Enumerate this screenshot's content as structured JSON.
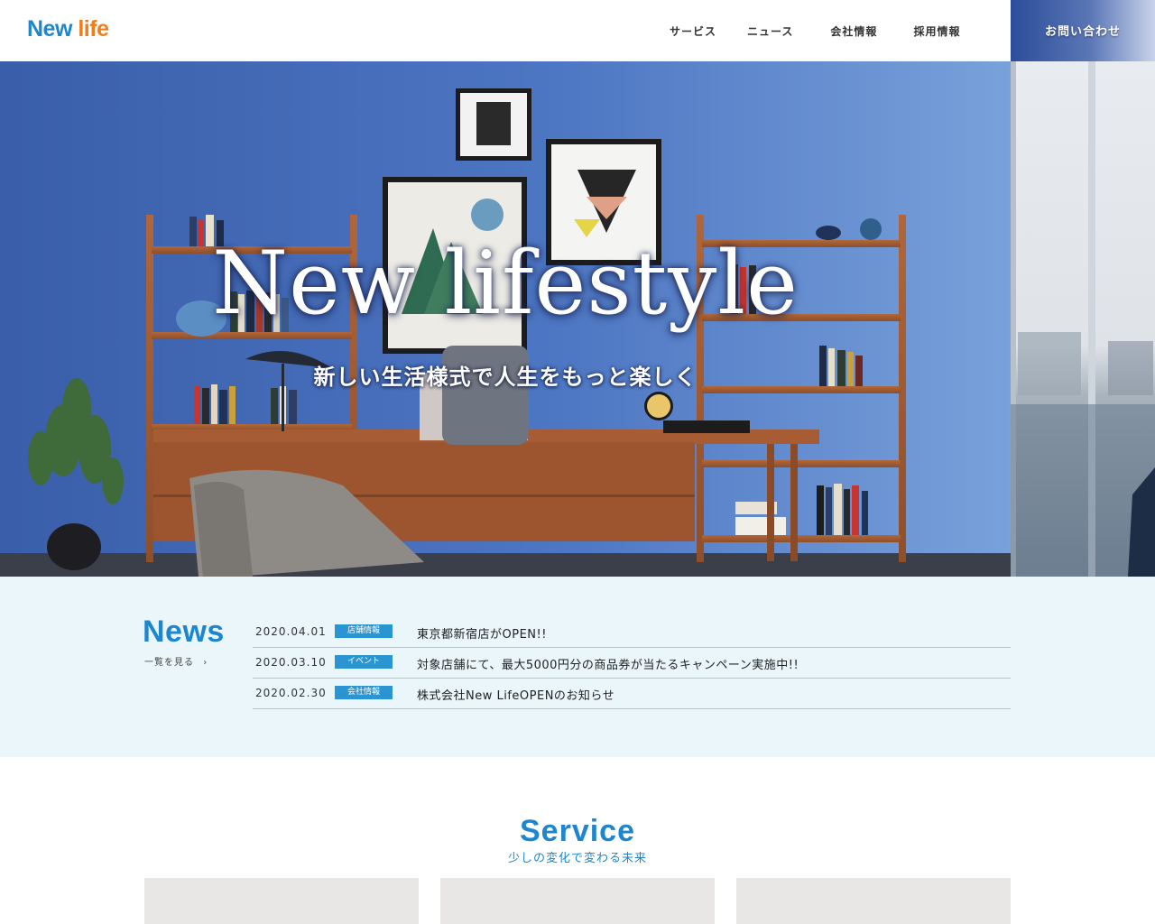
{
  "header": {
    "logo_part1": "New",
    "logo_part2": "life",
    "nav": [
      {
        "label": "サービス"
      },
      {
        "label": "ニュース"
      },
      {
        "label": "会社情報"
      },
      {
        "label": "採用情報"
      }
    ],
    "contact_label": "お問い合わせ"
  },
  "hero": {
    "title": "New lifestyle",
    "subtitle": "新しい生活様式で人生をもっと楽しく"
  },
  "news": {
    "title": "News",
    "more_label": "一覧を見る",
    "more_icon": "chevron-right-icon",
    "items": [
      {
        "date": "2020.04.01",
        "category": "店舗情報",
        "text": "東京都新宿店がOPEN!!"
      },
      {
        "date": "2020.03.10",
        "category": "イベント",
        "text": "対象店舗にて、最大5000円分の商品券が当たるキャンペーン実施中!!"
      },
      {
        "date": "2020.02.30",
        "category": "会社情報",
        "text": "株式会社New LifeOPENのお知らせ"
      }
    ]
  },
  "service": {
    "title": "Service",
    "subtitle": "少しの変化で変わる未来"
  },
  "colors": {
    "brand_blue": "#1e86cf",
    "brand_orange": "#f07d1a",
    "news_bg": "#eaf6fa",
    "badge": "#2a95d0"
  }
}
